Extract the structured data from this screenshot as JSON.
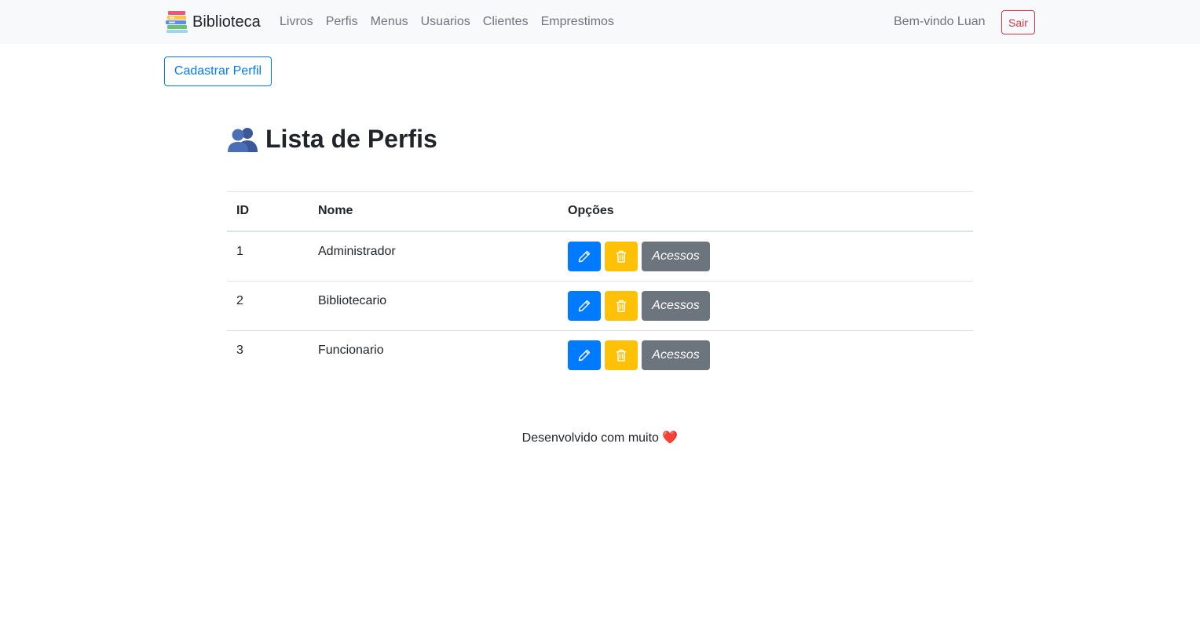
{
  "navbar": {
    "brand": "Biblioteca",
    "links": [
      "Livros",
      "Perfis",
      "Menus",
      "Usuarios",
      "Clientes",
      "Emprestimos"
    ],
    "welcome": "Bem-vindo Luan",
    "logout_label": "Sair"
  },
  "toolbar": {
    "create_label": "Cadastrar Perfil"
  },
  "page": {
    "title": "Lista de Perfis",
    "title_icon": "users-icon"
  },
  "table": {
    "headers": [
      "ID",
      "Nome",
      "Opções"
    ],
    "rows": [
      {
        "id": "1",
        "nome": "Administrador",
        "access_label": "Acessos"
      },
      {
        "id": "2",
        "nome": "Bibliotecario",
        "access_label": "Acessos"
      },
      {
        "id": "3",
        "nome": "Funcionario",
        "access_label": "Acessos"
      }
    ],
    "row_icons": [
      "pencil-icon",
      "trash-icon"
    ]
  },
  "footer": {
    "text": "Desenvolvido com muito",
    "heart": "❤️"
  },
  "colors": {
    "primary": "#007bff",
    "warning": "#ffc107",
    "secondary": "#6c757d",
    "danger": "#dc3545",
    "navbar_bg": "#f8f9fa"
  }
}
